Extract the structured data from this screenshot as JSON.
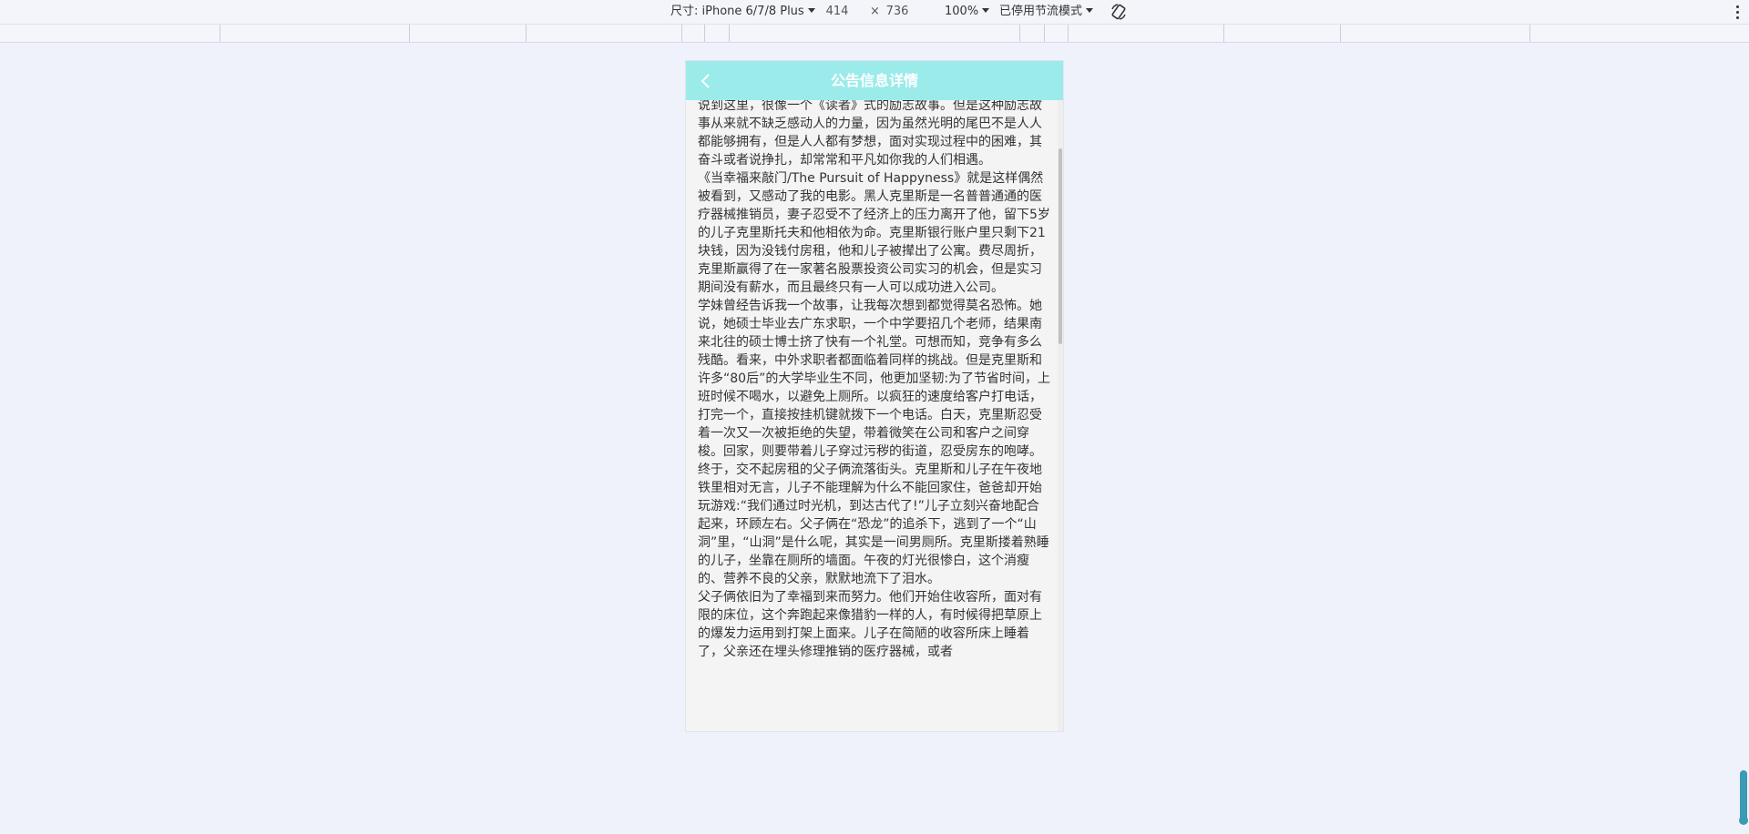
{
  "toolbar": {
    "size_label": "尺寸: iPhone 6/7/8 Plus",
    "width": "414",
    "times": "×",
    "height": "736",
    "zoom": "100%",
    "throttle": "已停用节流模式"
  },
  "header": {
    "title": "公告信息详情"
  },
  "article": {
    "paragraphs": [
      "说到这里，很像一个《读者》式的励志故事。但是这种励志故事从来就不缺乏感动人的力量，因为虽然光明的尾巴不是人人都能够拥有，但是人人都有梦想，面对实现过程中的困难，其奋斗或者说挣扎，却常常和平凡如你我的人们相遇。",
      "《当幸福来敲门/The Pursuit of Happyness》就是这样偶然被看到，又感动了我的电影。黑人克里斯是一名普普通通的医疗器械推销员，妻子忍受不了经济上的压力离开了他，留下5岁的儿子克里斯托夫和他相依为命。克里斯银行账户里只剩下21块钱，因为没钱付房租，他和儿子被撵出了公寓。费尽周折，克里斯赢得了在一家著名股票投资公司实习的机会，但是实习期间没有薪水，而且最终只有一人可以成功进入公司。",
      "学妹曾经告诉我一个故事，让我每次想到都觉得莫名恐怖。她说，她硕士毕业去广东求职，一个中学要招几个老师，结果南来北往的硕士博士挤了快有一个礼堂。可想而知，竞争有多么残酷。看来，中外求职者都面临着同样的挑战。但是克里斯和许多“80后”的大学毕业生不同，他更加坚韧:为了节省时间，上班时候不喝水，以避免上厕所。以疯狂的速度给客户打电话，打完一个，直接按挂机键就拨下一个电话。白天，克里斯忍受着一次又一次被拒绝的失望，带着微笑在公司和客户之间穿梭。回家，则要带着儿子穿过污秽的街道，忍受房东的咆哮。",
      "终于，交不起房租的父子俩流落街头。克里斯和儿子在午夜地铁里相对无言，儿子不能理解为什么不能回家住，爸爸却开始玩游戏:“我们通过时光机，到达古代了!”儿子立刻兴奋地配合起来，环顾左右。父子俩在“恐龙”的追杀下，逃到了一个“山洞”里，“山洞”是什么呢，其实是一间男厕所。克里斯搂着熟睡的儿子，坐靠在厕所的墙面。午夜的灯光很惨白，这个消瘦的、营养不良的父亲，默默地流下了泪水。",
      "父子俩依旧为了幸福到来而努力。他们开始住收容所，面对有限的床位，这个奔跑起来像猎豹一样的人，有时候得把草原上的爆发力运用到打架上面来。儿子在简陋的收容所床上睡着了，父亲还在埋头修理推销的医疗器械，或者"
    ]
  }
}
